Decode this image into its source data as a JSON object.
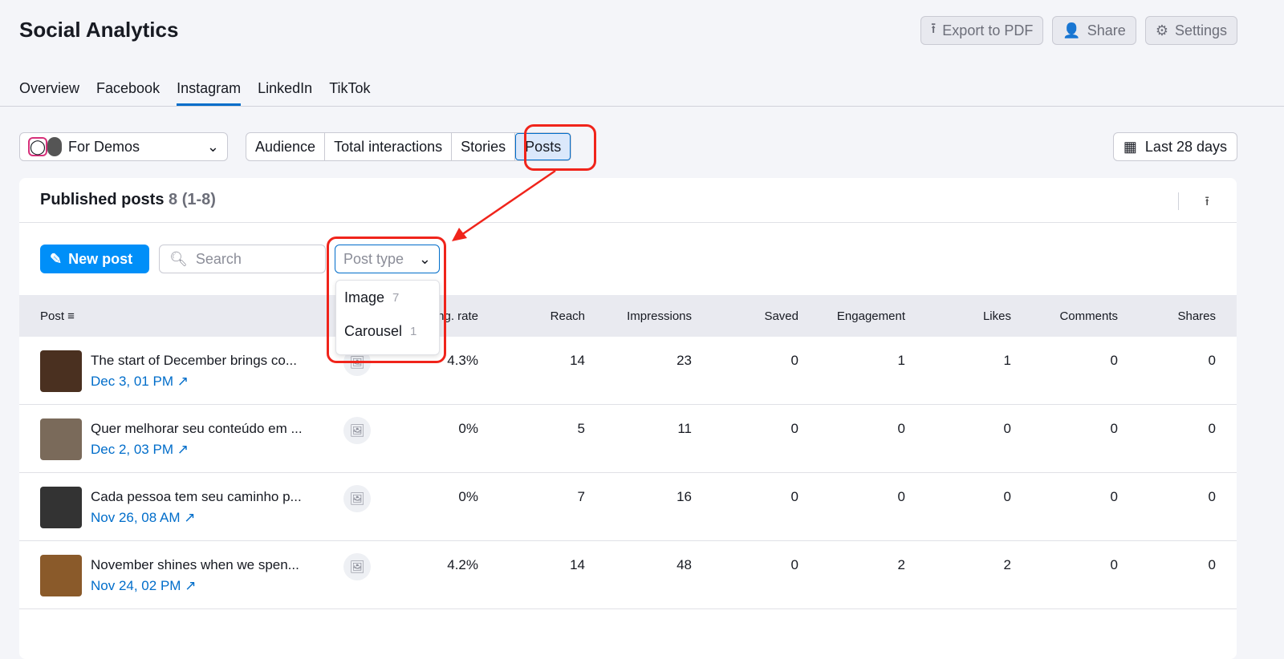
{
  "title": "Social Analytics",
  "top_buttons": {
    "export": "Export to PDF",
    "share": "Share",
    "settings": "Settings"
  },
  "tabs": [
    "Overview",
    "Facebook",
    "Instagram",
    "LinkedIn",
    "TikTok"
  ],
  "active_tab": "Instagram",
  "account": "For Demos",
  "segments": [
    "Audience",
    "Total interactions",
    "Stories",
    "Posts"
  ],
  "date_range": "Last 28 days",
  "card": {
    "title": "Published posts",
    "count": "8 (1-8)"
  },
  "toolbar": {
    "new_post": "New post",
    "search_placeholder": "Search",
    "post_type": "Post type"
  },
  "dropdown": [
    {
      "label": "Image",
      "count": "7"
    },
    {
      "label": "Carousel",
      "count": "1"
    }
  ],
  "columns": [
    "Post",
    "Eng. rate",
    "Reach",
    "Impressions",
    "Saved",
    "Engagement",
    "Likes",
    "Comments",
    "Shares"
  ],
  "rows": [
    {
      "text": "The start of December brings co...",
      "date": "Dec 3, 01 PM",
      "values": [
        "4.3%",
        "14",
        "23",
        "0",
        "1",
        "1",
        "0",
        "0"
      ]
    },
    {
      "text": "Quer melhorar seu conteúdo em ...",
      "date": "Dec 2, 03 PM",
      "values": [
        "0%",
        "5",
        "11",
        "0",
        "0",
        "0",
        "0",
        "0"
      ]
    },
    {
      "text": "Cada pessoa tem seu caminho p...",
      "date": "Nov 26, 08 AM",
      "values": [
        "0%",
        "7",
        "16",
        "0",
        "0",
        "0",
        "0",
        "0"
      ]
    },
    {
      "text": "November shines when we spen...",
      "date": "Nov 24, 02 PM",
      "values": [
        "4.2%",
        "14",
        "48",
        "0",
        "2",
        "2",
        "0",
        "0"
      ]
    }
  ],
  "colors": {
    "accent": "#008ff8",
    "link": "#006dca",
    "highlight": "#f0241b"
  }
}
